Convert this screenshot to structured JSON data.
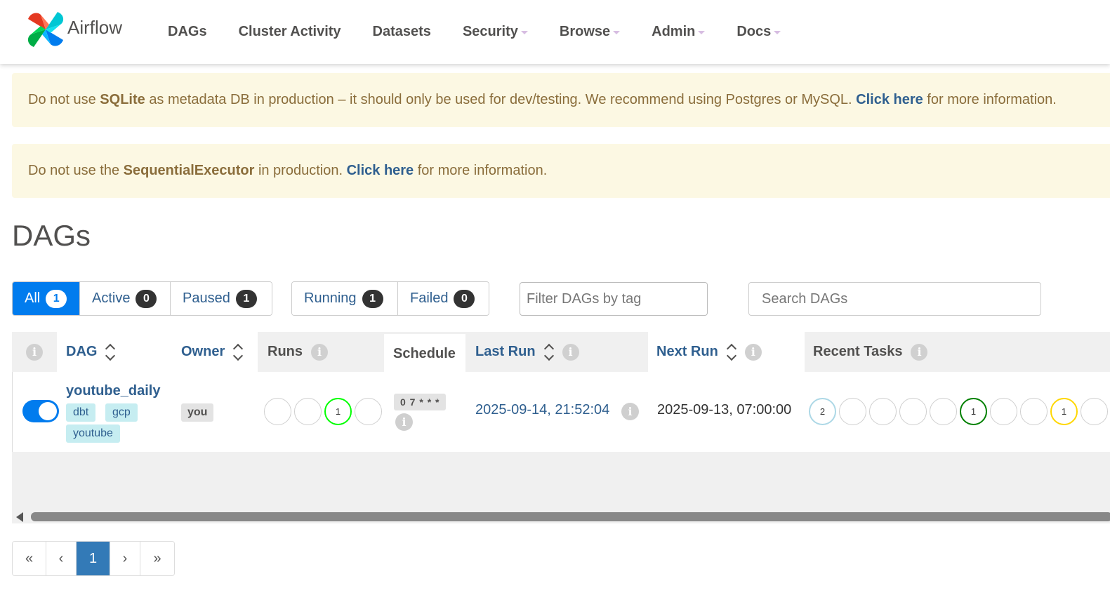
{
  "navbar": {
    "brand": "Airflow",
    "items": [
      {
        "label": "DAGs",
        "dropdown": false
      },
      {
        "label": "Cluster Activity",
        "dropdown": false
      },
      {
        "label": "Datasets",
        "dropdown": false
      },
      {
        "label": "Security",
        "dropdown": true
      },
      {
        "label": "Browse",
        "dropdown": true
      },
      {
        "label": "Admin",
        "dropdown": true
      },
      {
        "label": "Docs",
        "dropdown": true
      }
    ]
  },
  "alerts": {
    "sqlite": {
      "pre": "Do not use ",
      "strong": "SQLite",
      "mid": " as metadata DB in production – it should only be used for dev/testing. We recommend using Postgres or MySQL. ",
      "link": "Click here",
      "post": " for more information."
    },
    "executor": {
      "pre": "Do not use the ",
      "strong": "SequentialExecutor",
      "mid": " in production. ",
      "link": "Click here",
      "post": " for more information."
    }
  },
  "page_title": "DAGs",
  "filters": {
    "all": {
      "label": "All",
      "count": "1"
    },
    "active": {
      "label": "Active",
      "count": "0"
    },
    "paused": {
      "label": "Paused",
      "count": "1"
    },
    "running": {
      "label": "Running",
      "count": "1"
    },
    "failed": {
      "label": "Failed",
      "count": "0"
    },
    "tag_placeholder": "Filter DAGs by tag",
    "search_placeholder": "Search DAGs"
  },
  "table": {
    "headers": {
      "info": "i",
      "dag": "DAG",
      "owner": "Owner",
      "runs": "Runs",
      "schedule": "Schedule",
      "last_run": "Last Run",
      "next_run": "Next Run",
      "recent_tasks": "Recent Tasks"
    },
    "row": {
      "dag_id": "youtube_daily",
      "tags": [
        "dbt",
        "gcp",
        "youtube"
      ],
      "owner": "you",
      "runs": [
        "",
        "",
        "1",
        ""
      ],
      "schedule": "0 7 * * *",
      "last_run": "2025-09-14, 21:52:04",
      "next_run": "2025-09-13, 07:00:00",
      "recent_tasks": [
        "2",
        "",
        "",
        "",
        "",
        "1",
        "",
        "",
        "1",
        ""
      ]
    },
    "colors": {
      "run_success": "#00ff00",
      "task_queued": "#add8e6",
      "task_success": "#008000",
      "task_up_for_retry": "#ffd700"
    }
  },
  "pagination": {
    "first": "«",
    "prev": "‹",
    "current": "1",
    "next": "›",
    "last": "»"
  }
}
